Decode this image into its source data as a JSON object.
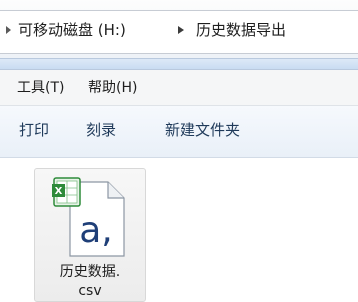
{
  "address": {
    "drive": "可移动磁盘 (H:)",
    "folder": "历史数据导出"
  },
  "menu": {
    "tools": "工具(T)",
    "help": "帮助(H)"
  },
  "toolbar": {
    "print": "打印",
    "burn": "刻录",
    "new_folder": "新建文件夹"
  },
  "files": [
    {
      "name_line1": "历史数据.",
      "name_line2": "csv",
      "icon": "excel-csv-file-icon",
      "badge_letter": "a,"
    }
  ],
  "colors": {
    "excel_green": "#2e8b3a",
    "stripe_blue": "#c9dcf2",
    "toolbar_text": "#1f3a5a"
  }
}
